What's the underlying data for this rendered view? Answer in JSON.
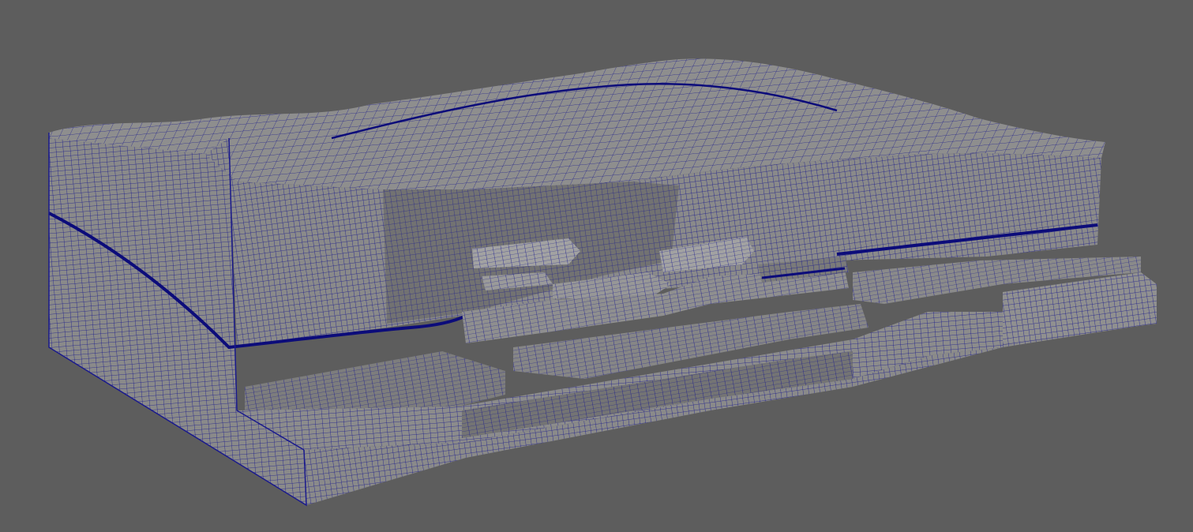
{
  "viewport": {
    "background": "#5d5d5d",
    "display_mode": "wireframe-on-shaded",
    "mesh": {
      "name": "terrain-block-mesh",
      "surface_color": "#8c8c8c",
      "shadow_color": "#6f6f6f",
      "highlight_color": "#a7a7a7",
      "wire_color": "#1a1a8c",
      "horizon_line_color": "#0c0c7a"
    }
  }
}
